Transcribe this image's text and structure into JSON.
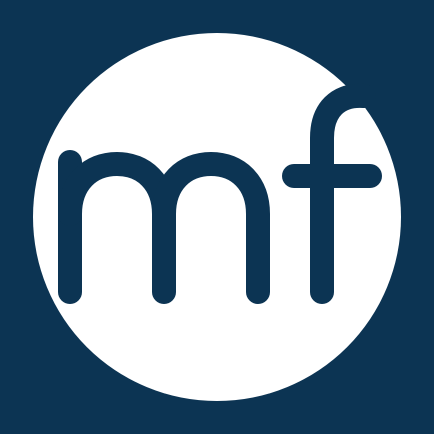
{
  "logo": {
    "text": "mf",
    "background_color": "#0c3453",
    "circle_color": "#ffffff",
    "letter_color": "#0c3453",
    "icon": "mf-logo-icon"
  }
}
